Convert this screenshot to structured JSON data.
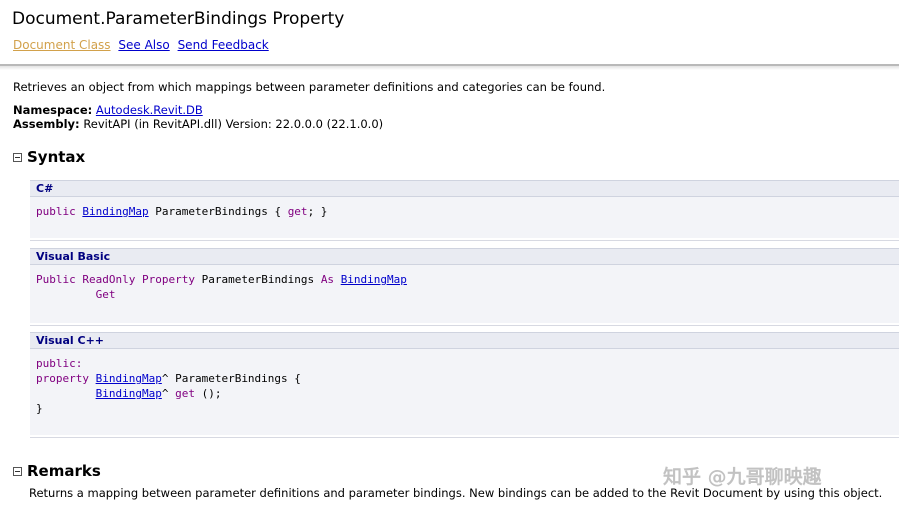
{
  "header": {
    "title": "Document.ParameterBindings Property",
    "links": {
      "document_class": "Document Class",
      "see_also": "See Also",
      "send_feedback": "Send Feedback"
    }
  },
  "summary": "Retrieves an object from which mappings between parameter definitions and categories can be found.",
  "meta": {
    "namespace_label": "Namespace:",
    "namespace_value": "Autodesk.Revit.DB",
    "assembly_label": "Assembly:",
    "assembly_value": "RevitAPI (in RevitAPI.dll) Version: 22.0.0.0 (22.1.0.0)"
  },
  "syntax": {
    "title": "Syntax",
    "blocks": [
      {
        "lang": "C#",
        "tokens": {
          "kw_public": "public",
          "type": "BindingMap",
          "name": " ParameterBindings { ",
          "kw_get": "get",
          "end": "; }"
        }
      },
      {
        "lang": "Visual Basic",
        "tokens": {
          "kw_public": "Public",
          "kw_readonly": "ReadOnly",
          "kw_property": "Property",
          "name": " ParameterBindings ",
          "kw_as": "As",
          "type": "BindingMap",
          "indent": "         ",
          "kw_get": "Get"
        }
      },
      {
        "lang": "Visual C++",
        "tokens": {
          "kw_public": "public:",
          "kw_property": "property",
          "type": "BindingMap",
          "after_type": "^ ParameterBindings {",
          "indent": "         ",
          "type2": "BindingMap",
          "after_type2": "^ ",
          "kw_get": "get",
          "after_get": " ();",
          "close": "}"
        }
      }
    ]
  },
  "remarks": {
    "title": "Remarks",
    "text": "Returns a mapping between parameter definitions and parameter bindings. New bindings can be added to the Revit Document by using this object."
  },
  "watermark": "知乎 @九哥聊映趣"
}
